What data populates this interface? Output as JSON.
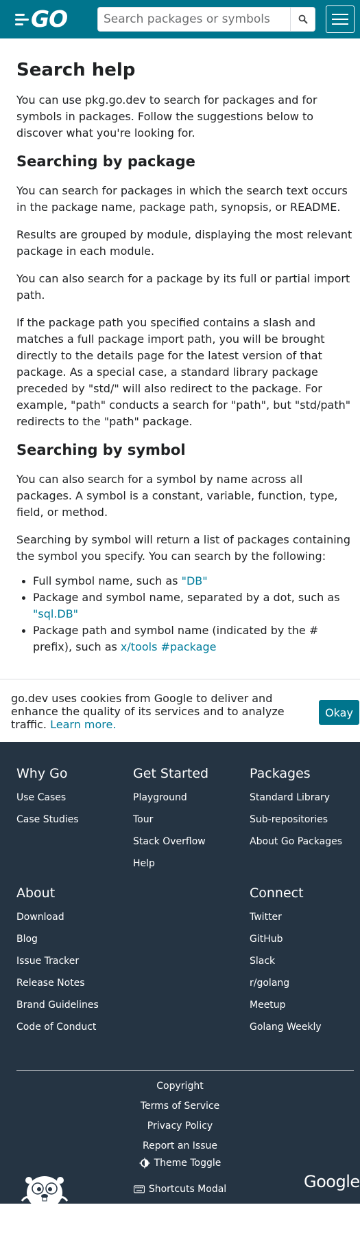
{
  "header": {
    "logo_text": "GO",
    "search_placeholder": "Search packages or symbols",
    "icons": {
      "search": "search-icon",
      "menu": "menu-icon"
    },
    "colors": {
      "header_bg": "#00758d",
      "link": "#007d9c",
      "footer_bg": "#253443"
    }
  },
  "main": {
    "title": "Search help",
    "intro": "You can use pkg.go.dev to search for packages and for symbols in packages. Follow the suggestions below to discover what you're looking for.",
    "package_section": {
      "heading": "Searching by package",
      "p1": "You can search for packages in which the search text occurs in the package name, package path, synopsis, or README.",
      "p2": "Results are grouped by module, displaying the most relevant package in each module.",
      "p3": "You can also search for a package by its full or partial import path.",
      "p4": "If the package path you specified contains a slash and matches a full package import path, you will be brought directly to the details page for the latest version of that package. As a special case, a standard library package preceded by \"std/\" will also redirect to the package. For example, \"path\" conducts a search for \"path\", but \"std/path\" redirects to the \"path\" package."
    },
    "symbol_section": {
      "heading": "Searching by symbol",
      "p1": "You can also search for a symbol by name across all packages. A symbol is a constant, variable, function, type, field, or method.",
      "p2": "Searching by symbol will return a list of packages containing the symbol you specify. You can search by the following:",
      "items": [
        {
          "text": "Full symbol name, such as ",
          "link": "\"DB\""
        },
        {
          "text": "Package and symbol name, separated by a dot, such as ",
          "link": "\"sql.DB\""
        },
        {
          "text": "Package path and symbol name (indicated by the # prefix), such as ",
          "link": "x/tools #package"
        }
      ]
    }
  },
  "cookie": {
    "message": "go.dev uses cookies from Google to deliver and enhance the quality of its services and to analyze traffic.",
    "learn_more": "Learn more.",
    "okay": "Okay"
  },
  "footer": {
    "why_go": {
      "heading": "Why Go",
      "items": [
        "Use Cases",
        "Case Studies"
      ]
    },
    "get_started": {
      "heading": "Get Started",
      "items": [
        "Playground",
        "Tour",
        "Stack Overflow",
        "Help"
      ]
    },
    "packages": {
      "heading": "Packages",
      "items": [
        "Standard Library",
        "Sub-repositories",
        "About Go Packages"
      ]
    },
    "about": {
      "heading": "About",
      "items": [
        "Download",
        "Blog",
        "Issue Tracker",
        "Release Notes",
        "Brand Guidelines",
        "Code of Conduct"
      ]
    },
    "connect": {
      "heading": "Connect",
      "items": [
        "Twitter",
        "GitHub",
        "Slack",
        "r/golang",
        "Meetup",
        "Golang Weekly"
      ]
    },
    "legal": [
      "Copyright",
      "Terms of Service",
      "Privacy Policy",
      "Report an Issue"
    ],
    "theme_toggle": "Theme Toggle",
    "shortcuts_modal": "Shortcuts Modal",
    "google_logo_text": "Google",
    "icons": {
      "theme": "theme-toggle-icon",
      "keyboard": "keyboard-icon",
      "gopher": "gopher-logo"
    }
  }
}
